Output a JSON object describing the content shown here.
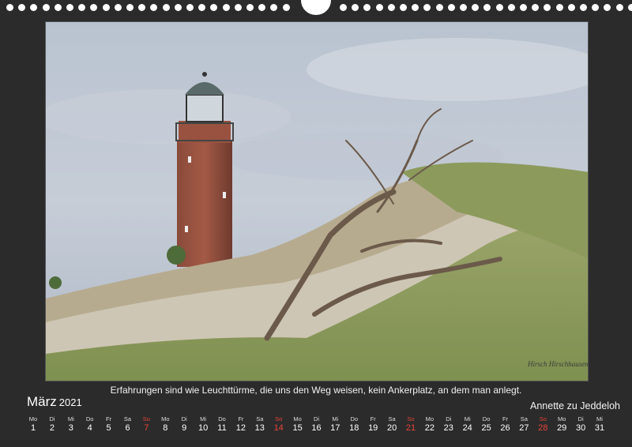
{
  "calendar": {
    "month": "März",
    "year": "2021",
    "quote": "Erfahrungen sind wie Leuchttürme, die uns den Weg weisen, kein Ankerplatz, an dem man anlegt.",
    "author": "Annette zu Jeddeloh",
    "signature": "Hirsch Hirschhausen",
    "photo_description_icon": "lighthouse-dune-photo",
    "sunday_color": "#e8443a",
    "days": [
      {
        "wd": "Mo",
        "d": "1"
      },
      {
        "wd": "Di",
        "d": "2"
      },
      {
        "wd": "Mi",
        "d": "3"
      },
      {
        "wd": "Do",
        "d": "4"
      },
      {
        "wd": "Fr",
        "d": "5"
      },
      {
        "wd": "Sa",
        "d": "6"
      },
      {
        "wd": "So",
        "d": "7",
        "sun": true
      },
      {
        "wd": "Mo",
        "d": "8"
      },
      {
        "wd": "Di",
        "d": "9"
      },
      {
        "wd": "Mi",
        "d": "10"
      },
      {
        "wd": "Do",
        "d": "11"
      },
      {
        "wd": "Fr",
        "d": "12"
      },
      {
        "wd": "Sa",
        "d": "13"
      },
      {
        "wd": "So",
        "d": "14",
        "sun": true
      },
      {
        "wd": "Mo",
        "d": "15"
      },
      {
        "wd": "Di",
        "d": "16"
      },
      {
        "wd": "Mi",
        "d": "17"
      },
      {
        "wd": "Do",
        "d": "18"
      },
      {
        "wd": "Fr",
        "d": "19"
      },
      {
        "wd": "Sa",
        "d": "20"
      },
      {
        "wd": "So",
        "d": "21",
        "sun": true
      },
      {
        "wd": "Mo",
        "d": "22"
      },
      {
        "wd": "Di",
        "d": "23"
      },
      {
        "wd": "Mi",
        "d": "24"
      },
      {
        "wd": "Do",
        "d": "25"
      },
      {
        "wd": "Fr",
        "d": "26"
      },
      {
        "wd": "Sa",
        "d": "27"
      },
      {
        "wd": "So",
        "d": "28",
        "sun": true
      },
      {
        "wd": "Mo",
        "d": "29"
      },
      {
        "wd": "Di",
        "d": "30"
      },
      {
        "wd": "Mi",
        "d": "31"
      }
    ]
  }
}
